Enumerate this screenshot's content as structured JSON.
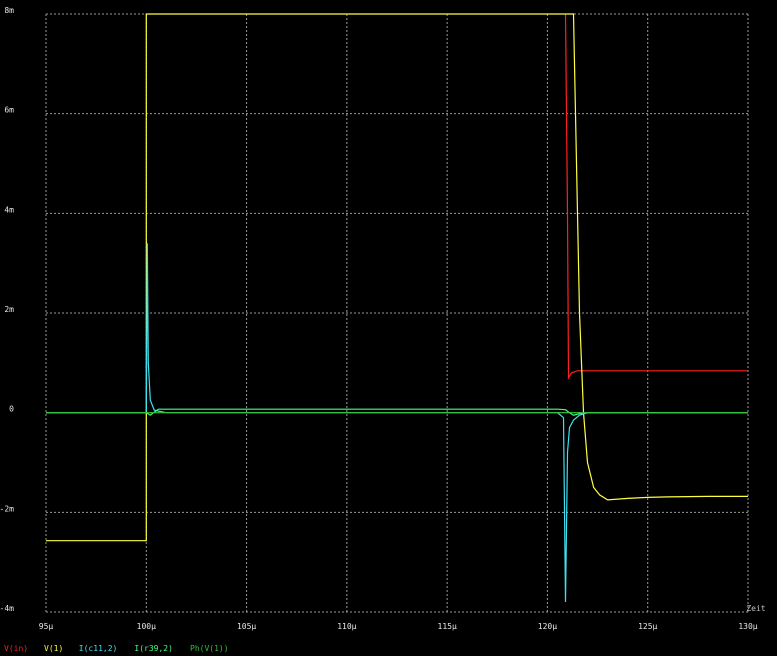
{
  "chart_data": {
    "type": "line",
    "xlabel": "Zeit",
    "x_unit": "µs",
    "xlim": [
      95,
      130
    ],
    "ylim": [
      -4,
      8
    ],
    "y_unit": "mA",
    "grid": true,
    "legend_position": "bottom-left",
    "x_tick_labels": [
      "95µ",
      "100µ",
      "105µ",
      "110µ",
      "115µ",
      "120µ",
      "125µ",
      "130µ"
    ],
    "x_tick_values": [
      95,
      100,
      105,
      110,
      115,
      120,
      125,
      130
    ],
    "y_tick_labels": [
      "-4m",
      "-2m",
      "0",
      "2m",
      "4m",
      "6m",
      "8m"
    ],
    "y_tick_values": [
      -4,
      -2,
      0,
      2,
      4,
      6,
      8
    ],
    "series": [
      {
        "name": "V(in)",
        "color": "#ff2020",
        "x": [
          120.9,
          121.0,
          121.05,
          121.2,
          121.5,
          122.0,
          124.0,
          126.0,
          128.0,
          130.0
        ],
        "y": [
          8.0,
          4.0,
          0.7,
          0.8,
          0.84,
          0.84,
          0.84,
          0.84,
          0.84,
          0.84
        ]
      },
      {
        "name": "V(1)",
        "color": "#ffff40",
        "x": [
          95,
          99.95,
          100.0,
          100.0,
          101.5,
          120.9,
          121.3,
          121.4,
          121.6,
          121.8,
          122.0,
          122.3,
          122.6,
          123.0,
          124.0,
          125.0,
          126.0,
          128.0,
          130.0
        ],
        "y": [
          -2.57,
          -2.57,
          -2.57,
          8.0,
          8.0,
          8.0,
          8.0,
          6.0,
          2.0,
          0.0,
          -1.0,
          -1.5,
          -1.65,
          -1.75,
          -1.72,
          -1.7,
          -1.69,
          -1.68,
          -1.68
        ]
      },
      {
        "name": "I(c11,2)",
        "color": "#40e0f0",
        "x": [
          95,
          99.95,
          100.0,
          100.05,
          100.1,
          100.2,
          100.4,
          101.0,
          120.5,
          120.8,
          120.9,
          121.0,
          121.1,
          121.3,
          121.6,
          122.0,
          123.0,
          130.0
        ],
        "y": [
          0.0,
          0.0,
          0.0,
          3.4,
          1.0,
          0.25,
          0.05,
          0.0,
          0.0,
          -0.1,
          -3.8,
          -0.8,
          -0.3,
          -0.15,
          -0.05,
          0.0,
          0.0,
          0.0
        ]
      },
      {
        "name": "I(r39,2)",
        "color": "#40ff80",
        "x": [
          95,
          99.95,
          100.0,
          100.2,
          100.6,
          101.0,
          120.5,
          120.9,
          121.1,
          121.3,
          121.6,
          122.0,
          130.0
        ],
        "y": [
          0.0,
          0.0,
          0.0,
          -0.05,
          0.07,
          0.07,
          0.07,
          0.06,
          0.0,
          -0.05,
          -0.02,
          0.0,
          0.0
        ]
      },
      {
        "name": "Ph(V(1))",
        "color": "#30c030",
        "x": [
          95,
          130
        ],
        "y": [
          0.0,
          0.0
        ]
      }
    ]
  }
}
